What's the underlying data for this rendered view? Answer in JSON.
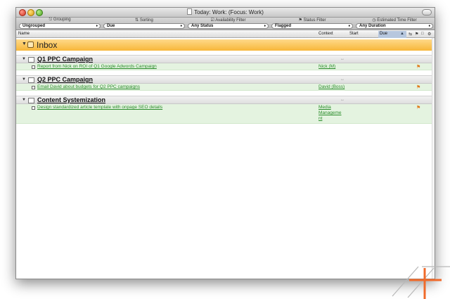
{
  "window": {
    "title": "Today: Work: (Focus: Work)"
  },
  "filters": [
    {
      "label": "Grouping",
      "value": "Ungrouped"
    },
    {
      "label": "Sorting",
      "value": "Due"
    },
    {
      "label": "Availability Filter",
      "value": "Any Status"
    },
    {
      "label": "Status Filter",
      "value": "Flagged"
    },
    {
      "label": "Estimated Time Filter",
      "value": "Any Duration"
    }
  ],
  "columns": {
    "name": "Name",
    "context": "Context",
    "start": "Start",
    "due": "Due"
  },
  "inbox": {
    "label": "Inbox"
  },
  "projects": [
    {
      "title": "Q1 PPC Campaign",
      "tasks": [
        {
          "title": "Report from Nick on ROI of Q1 Google Adwords Campaign",
          "context": "Nick (M)"
        }
      ]
    },
    {
      "title": "Q2 PPC Campaign",
      "tasks": [
        {
          "title": "Email David about budgets for Q2 PPC campaigns",
          "context": "David (Boss)"
        }
      ]
    },
    {
      "title": "Content Systemization",
      "tasks": [
        {
          "title": "Design standardized article template with onpage SEO details",
          "context": "Media Manageme nt"
        }
      ]
    }
  ],
  "colors": {
    "inbox": "#f7b73a",
    "task_row": "#e4f3e0",
    "task_text": "#2a8c2a",
    "flag": "#e07a1a",
    "logo": "#f06a2a"
  }
}
